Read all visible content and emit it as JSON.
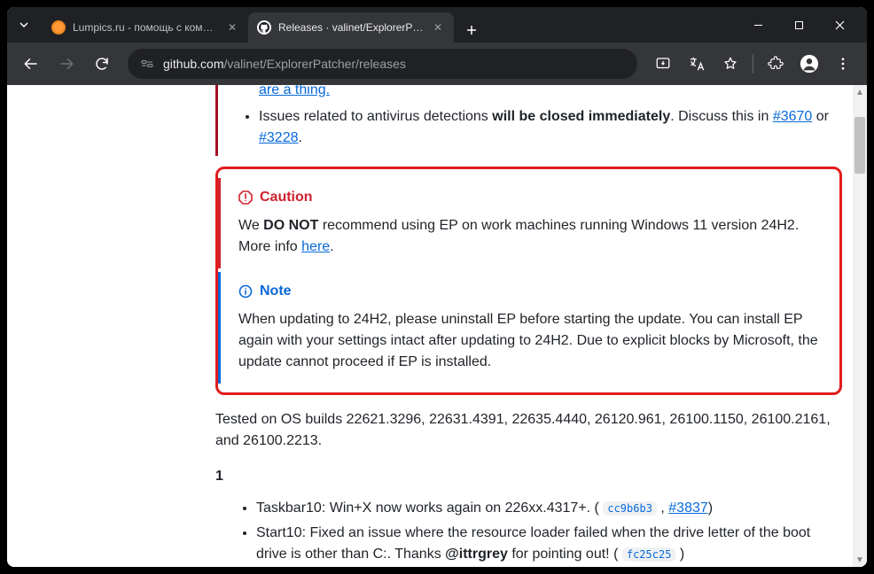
{
  "tabs": [
    {
      "title": "Lumpics.ru - помощь с компью",
      "active": false
    },
    {
      "title": "Releases · valinet/ExplorerPatch",
      "active": true
    }
  ],
  "url": {
    "host": "github.com",
    "path": "/valinet/ExplorerPatcher/releases"
  },
  "important": {
    "link_tail": "are a thing.",
    "av_text_pre": "Issues related to antivirus detections ",
    "av_bold": "will be closed immediately",
    "av_text_post": ". Discuss this in ",
    "av_link1": "#3670",
    "av_or": " or ",
    "av_link2": "#3228",
    "av_end": "."
  },
  "caution": {
    "title": "Caution",
    "pre": "We ",
    "bold": "DO NOT",
    "post": " recommend using EP on work machines running Windows 11 version 24H2. More info ",
    "link": "here",
    "end": "."
  },
  "note": {
    "title": "Note",
    "body": "When updating to 24H2, please uninstall EP before starting the update. You can install EP again with your settings intact after updating to 24H2. Due to explicit blocks by Microsoft, the update cannot proceed if EP is installed."
  },
  "tested": "Tested on OS builds 22621.3296, 22631.4391, 22635.4440, 26120.961, 26100.1150, 26100.2161, and 26100.2213.",
  "section_num": "1",
  "changes": {
    "c1_pre": "Taskbar10: Win+X now works again on 226xx.4317+. (",
    "c1_commit": "cc9b6b3",
    "c1_mid": ", ",
    "c1_issue": "#3837",
    "c1_end": ")",
    "c2_pre": "Start10: Fixed an issue where the resource loader failed when the drive letter of the boot drive is other than C:. Thanks ",
    "c2_user": "@ittrgrey",
    "c2_mid": " for pointing out! (",
    "c2_commit": "fc25c25",
    "c2_end": ")"
  }
}
